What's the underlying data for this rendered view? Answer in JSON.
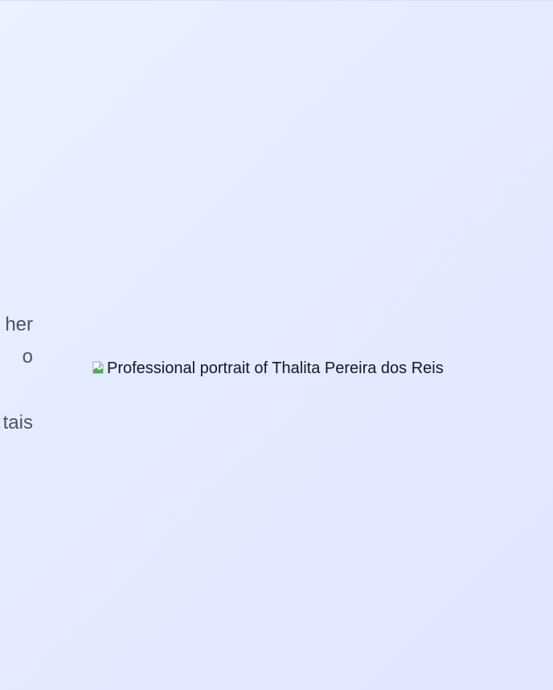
{
  "side_text": {
    "line1": "her",
    "line2": "o",
    "line3": "tais"
  },
  "portrait": {
    "alt_text": "Professional portrait of Thalita Pereira dos Reis",
    "icon": "broken-image-icon"
  }
}
